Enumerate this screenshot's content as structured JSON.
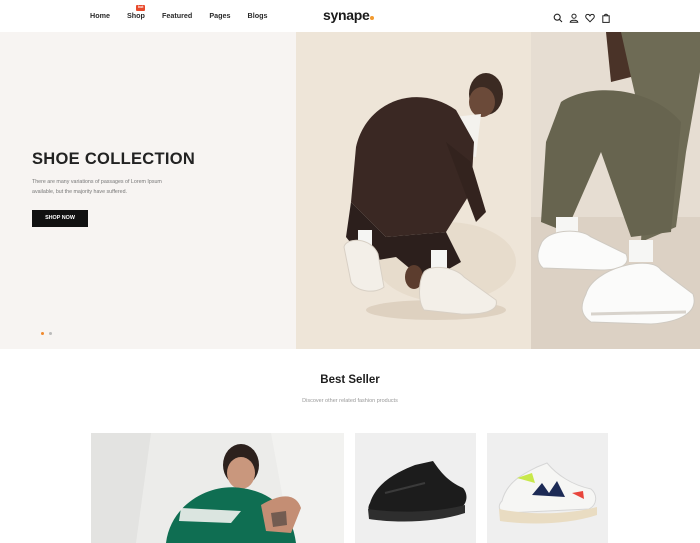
{
  "nav": {
    "items": [
      {
        "label": "Home"
      },
      {
        "label": "Shop",
        "badge": "hot"
      },
      {
        "label": "Featured"
      },
      {
        "label": "Pages"
      },
      {
        "label": "Blogs"
      }
    ]
  },
  "logo": {
    "text": "synape",
    "accent_color": "#f29a2e"
  },
  "header_icons": [
    "search-icon",
    "user-icon",
    "heart-icon",
    "bag-icon"
  ],
  "hero": {
    "title": "SHOE COLLECTION",
    "text": "There are many variations of passages of Lorem Ipsum available, but the majority have suffered.",
    "button_label": "SHOP NOW",
    "slides": 2,
    "active_slide": 1,
    "accent_color": "#f0892e"
  },
  "best_seller": {
    "title": "Best Seller",
    "subtitle": "Discover other related fashion products"
  }
}
